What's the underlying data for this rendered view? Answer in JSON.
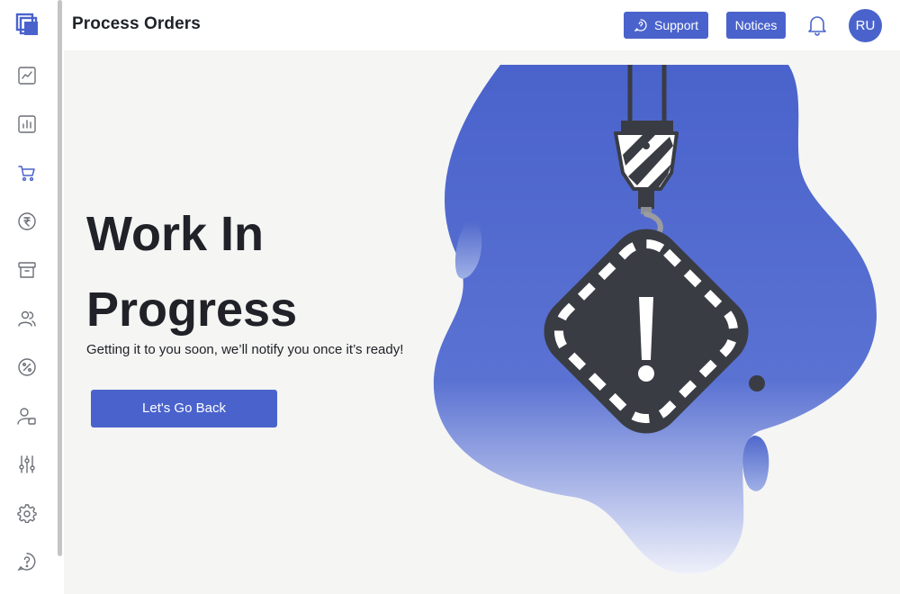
{
  "header": {
    "title": "Process Orders",
    "support_label": "Support",
    "notices_label": "Notices",
    "avatar_initials": "RU"
  },
  "sidebar": {
    "items": [
      {
        "name": "analytics",
        "icon": "trend-chart-icon"
      },
      {
        "name": "reports",
        "icon": "bar-chart-icon"
      },
      {
        "name": "orders",
        "icon": "cart-icon",
        "active": true
      },
      {
        "name": "payments",
        "icon": "rupee-icon"
      },
      {
        "name": "archive",
        "icon": "archive-box-icon"
      },
      {
        "name": "users",
        "icon": "users-icon"
      },
      {
        "name": "discounts",
        "icon": "percent-icon"
      },
      {
        "name": "profile",
        "icon": "user-card-icon"
      },
      {
        "name": "filters",
        "icon": "sliders-icon"
      },
      {
        "name": "settings",
        "icon": "gear-icon"
      },
      {
        "name": "help",
        "icon": "help-icon"
      }
    ]
  },
  "main": {
    "title_line1": "Work In",
    "title_line2": "Progress",
    "subtitle": "Getting it to you soon, we’ll notify you once it’s ready!",
    "back_button_label": "Let's Go Back"
  },
  "colors": {
    "accent": "#4a63cc",
    "active_icon": "#4a63cc",
    "background": "#f5f5f4",
    "text_dark": "#202228",
    "sign_dark": "#3a3c44"
  }
}
